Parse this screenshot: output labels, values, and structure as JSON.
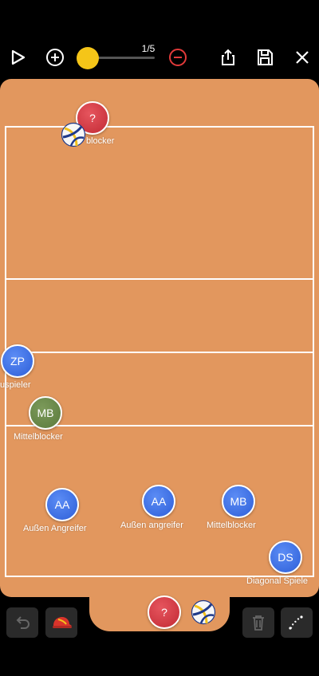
{
  "toolbar": {
    "page_indicator": "1/5",
    "icons": [
      "play-icon",
      "add-circle-icon",
      "slider-knob",
      "remove-circle-icon",
      "share-icon",
      "save-icon",
      "close-icon"
    ],
    "colors": {
      "accent": "#f5c518",
      "remove": "#e23a3a"
    }
  },
  "players": [
    {
      "id": "top-red",
      "role": "?",
      "label": "blocker",
      "color": "red"
    },
    {
      "id": "zp",
      "role": "ZP",
      "label": "uspieler",
      "color": "blue"
    },
    {
      "id": "mb-green",
      "role": "MB",
      "label": "Mittelblocker",
      "color": "green"
    },
    {
      "id": "aa-left",
      "role": "AA",
      "label": "Außen Angreifer",
      "color": "blue"
    },
    {
      "id": "aa-mid",
      "role": "AA",
      "label": "Außen angreifer",
      "color": "blue"
    },
    {
      "id": "mb-right",
      "role": "MB",
      "label": "Mittelblocker",
      "color": "blue"
    },
    {
      "id": "ds",
      "role": "DS",
      "label": "Diagonal Spiele",
      "color": "blue"
    }
  ],
  "bench": {
    "unknown_player": "?"
  },
  "bottom_bar": {
    "icons": [
      "undo-icon",
      "cap-icon",
      "trash-icon",
      "path-draw-icon"
    ]
  },
  "colors": {
    "court": "#e2975e",
    "lines": "#ffffff",
    "player_blue": "#3a6fe6",
    "player_red": "#d63a44",
    "player_green": "#6b8b4a"
  }
}
